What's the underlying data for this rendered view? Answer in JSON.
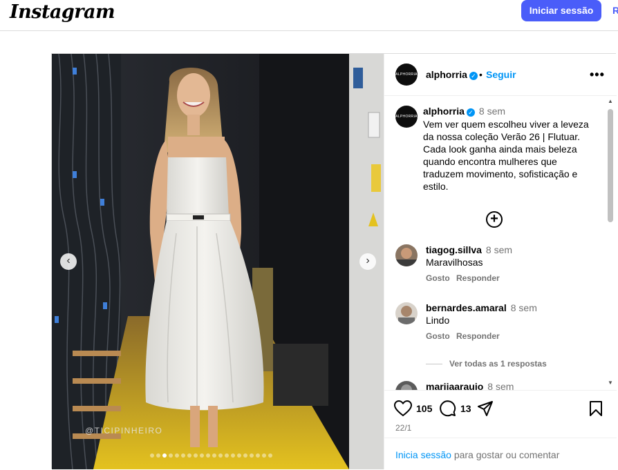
{
  "header": {
    "logo": "Instagram",
    "login_button": "Iniciar sessão",
    "signup_link": "R"
  },
  "media": {
    "watermark": "@TICIPINHEIRO",
    "prev_arrow": "‹",
    "next_arrow": "›",
    "slide_count": 20,
    "active_slide": 2
  },
  "post": {
    "username": "alphorria",
    "avatar_text": "ALPHORRIA",
    "follow_label": "Seguir",
    "separator": "•",
    "more_label": "•••",
    "caption": {
      "username": "alphorria",
      "time": "8 sem",
      "text": "Vem ver quem escolheu viver a leveza da nossa coleção Verão 26 | Flutuar. Cada look ganha ainda mais beleza quando encontra mulheres que traduzem movimento, sofisticação e estilo."
    },
    "load_more_icon": "+",
    "comments": [
      {
        "username": "tiagog.sillva",
        "time": "8 sem",
        "text": "Maravilhosas",
        "like": "Gosto",
        "reply": "Responder"
      },
      {
        "username": "bernardes.amaral",
        "time": "8 sem",
        "text": "Lindo",
        "like": "Gosto",
        "reply": "Responder"
      },
      {
        "username": "mariiaaraujo",
        "time": "8 sem",
        "text": "",
        "like": "",
        "reply": ""
      }
    ],
    "view_replies": "Ver todas as 1 respostas",
    "likes": "105",
    "comments_count": "13",
    "date": "22/1",
    "login_prompt_link": "Inicia sessão",
    "login_prompt_text": " para gostar ou comentar"
  },
  "colors": {
    "accent": "#4a5df9",
    "link": "#0095f6",
    "verified": "#0095f6",
    "muted": "#737373"
  }
}
